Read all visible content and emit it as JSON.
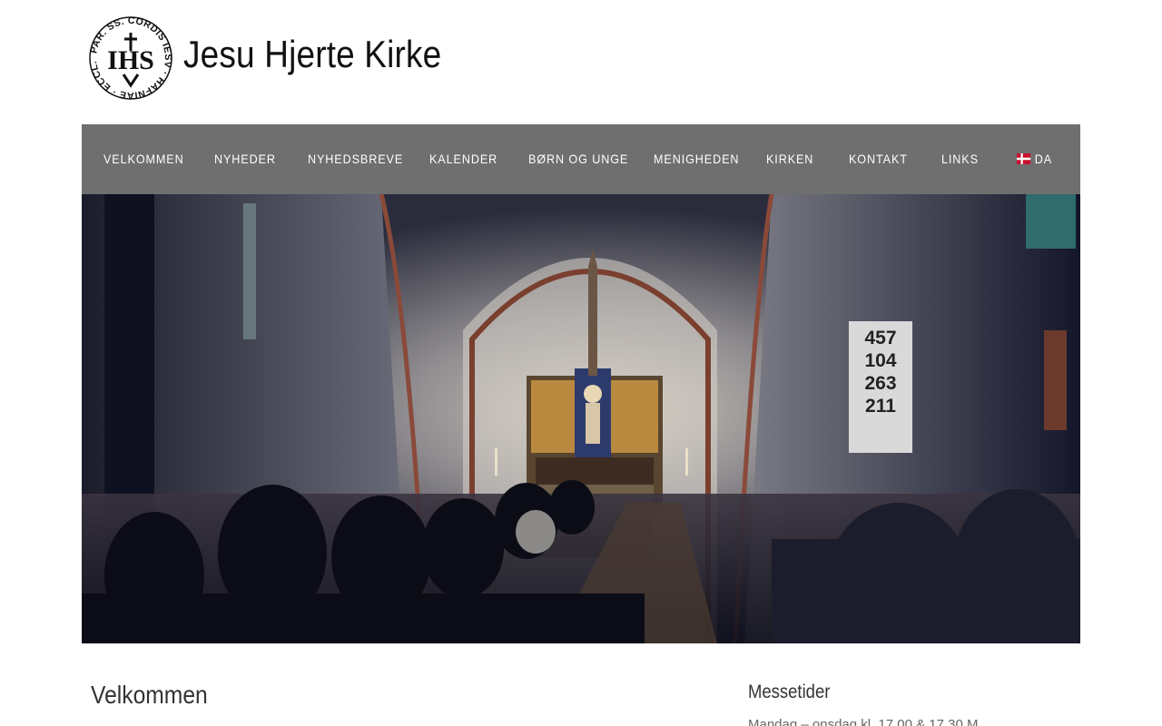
{
  "site": {
    "title": "Jesu Hjerte Kirke",
    "logo_text_ring": "PAR. SS. CORDIS IESV · HAFNIAE · ECCL.",
    "logo_monogram": "IHS"
  },
  "nav": {
    "items": [
      {
        "label": "VELKOMMEN"
      },
      {
        "label": "NYHEDER"
      },
      {
        "label": "NYHEDSBREVE"
      },
      {
        "label": "KALENDER"
      },
      {
        "label": "BØRN OG UNGE"
      },
      {
        "label": "MENIGHEDEN"
      },
      {
        "label": "KIRKEN"
      },
      {
        "label": "KONTAKT"
      },
      {
        "label": "LINKS"
      }
    ],
    "language": {
      "label": "DA",
      "flag": "danish-flag-icon"
    }
  },
  "hero": {
    "panel_numbers": [
      "457",
      "104",
      "263",
      "211"
    ]
  },
  "content": {
    "heading": "Velkommen"
  },
  "sidebar": {
    "heading": "Messetider",
    "first_line": "Mandag – onsdag kl. 17.00 & 17.30 M..."
  },
  "colors": {
    "nav_bg": "#6f6f6f",
    "nav_text": "#ffffff",
    "page_bg": "#ffffff"
  }
}
